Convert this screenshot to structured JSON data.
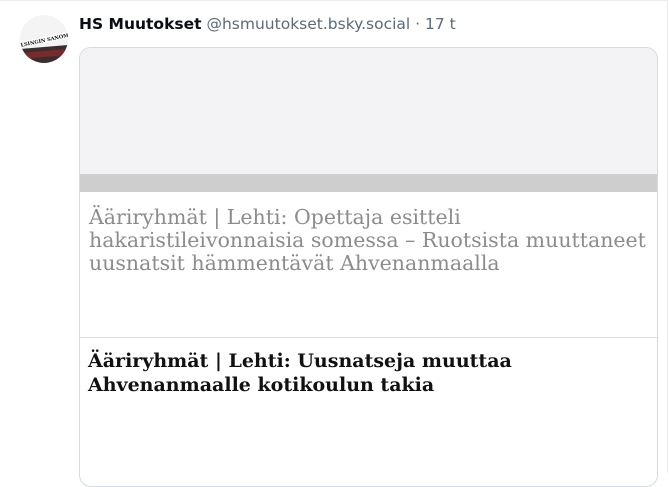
{
  "post": {
    "author": "HS Muutokset",
    "handle": "@hsmuutokset.bsky.social",
    "separator": "·",
    "time": "17 t",
    "avatar_icon": "newspaper-masthead-icon",
    "avatar_text": "HELSINGIN SANOMAT"
  },
  "embed": {
    "title": "Ääriryhmät | Lehti: Opettaja esitteli hakaristileivonnaisia somessa – Ruotsista muuttaneet uusnatsit hämmentävät Ahvenanmaalla",
    "headline": "Ääriryhmät | Lehti: Uusnatseja muuttaa Ahvenanmaalle kotikoulun takia"
  },
  "colors": {
    "handle": "#5b6a7a",
    "card_border": "#d4dbe2",
    "title_gray": "#8c8c8c",
    "image_strip": "#cecece"
  }
}
